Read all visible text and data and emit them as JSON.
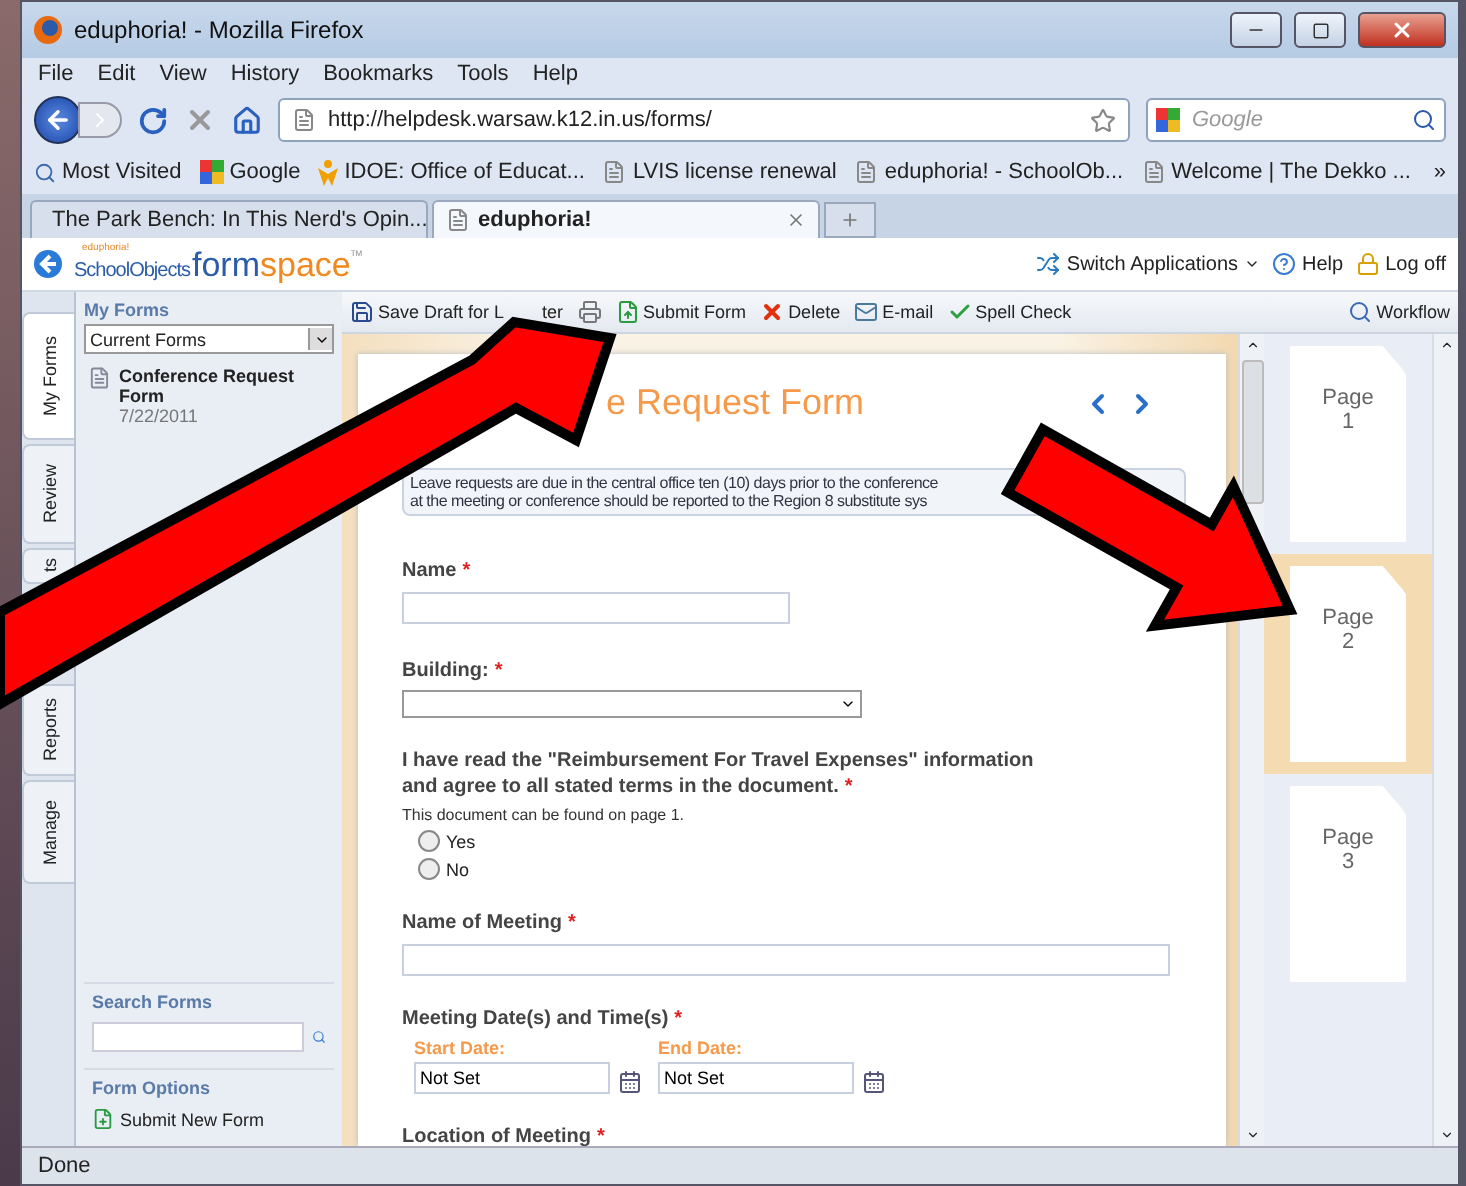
{
  "window": {
    "title": "eduphoria! - Mozilla Firefox"
  },
  "menu": [
    "File",
    "Edit",
    "View",
    "History",
    "Bookmarks",
    "Tools",
    "Help"
  ],
  "address": {
    "value": "http://helpdesk.warsaw.k12.in.us/forms/"
  },
  "search": {
    "placeholder": "Google"
  },
  "bookmarks": [
    {
      "label": "Most Visited",
      "kind": "folder"
    },
    {
      "label": "Google",
      "kind": "google"
    },
    {
      "label": "IDOE: Office of Educat...",
      "kind": "idoe"
    },
    {
      "label": "LVIS license renewal",
      "kind": "page"
    },
    {
      "label": "eduphoria! - SchoolOb...",
      "kind": "page"
    },
    {
      "label": "Welcome | The Dekko ...",
      "kind": "page"
    }
  ],
  "bookmarks_more": "»",
  "tabs": [
    {
      "label": "The Park Bench: In This Nerd's Opin...",
      "selected": false,
      "kind": "blog"
    },
    {
      "label": "eduphoria!",
      "selected": true,
      "kind": "page"
    }
  ],
  "app": {
    "logo_small": "eduphoria!",
    "logo_brand": "SchoolObjects",
    "logo_form": "form",
    "logo_space": "space",
    "logo_tm": "TM",
    "header_links": [
      {
        "label": "Switch Applications",
        "kind": "switch"
      },
      {
        "label": "Help",
        "kind": "help"
      },
      {
        "label": "Log off",
        "kind": "logoff"
      }
    ]
  },
  "side_tabs": [
    {
      "label": "My Forms",
      "selected": true
    },
    {
      "label": "Review",
      "selected": false
    },
    {
      "label": "ts",
      "selected": false
    },
    {
      "label": "Reports",
      "selected": false
    },
    {
      "label": "Manage",
      "selected": false
    }
  ],
  "sidebar": {
    "title": "My Forms",
    "filter": "Current Forms",
    "forms": [
      {
        "name": "Conference Request Form",
        "date": "7/22/2011"
      }
    ],
    "search_title": "Search Forms",
    "options_title": "Form Options",
    "options": [
      "Submit New Form"
    ]
  },
  "toolbar": [
    {
      "label": "Save Draft for L",
      "kind": "save"
    },
    {
      "label": "ter",
      "kind": "fragment"
    },
    {
      "kind": "print"
    },
    {
      "label": "Submit Form",
      "kind": "submit"
    },
    {
      "label": "Delete",
      "kind": "delete"
    },
    {
      "label": "E-mail",
      "kind": "email"
    },
    {
      "label": "Spell Check",
      "kind": "spell"
    }
  ],
  "workflow": "Workflow",
  "form": {
    "title": "e Request Form",
    "required_mark": "*",
    "notice": [
      "Leave requests are due in the central office ten (10) days prior to the conference",
      "at the meeting or conference should be reported to the Region 8 substitute sys"
    ],
    "fields": [
      {
        "kind": "short",
        "label": "Name",
        "required": true
      },
      {
        "kind": "select",
        "label": "Building:",
        "required": true
      },
      {
        "kind": "radio",
        "label": "I have read the \"Reimbursement For Travel Expenses\" information and agree to all stated terms in the document.",
        "required": true,
        "hint": "This document can be found on page 1.",
        "options": [
          {
            "label": "Yes",
            "selected": false
          },
          {
            "label": "No",
            "selected": false
          }
        ]
      },
      {
        "kind": "text",
        "label": "Name of Meeting",
        "required": true
      },
      {
        "kind": "dates",
        "label": "Meeting Date(s) and Time(s)",
        "required": true,
        "dates": [
          {
            "label": "Start Date:",
            "value": "Not Set"
          },
          {
            "label": "End Date:",
            "value": "Not Set"
          }
        ]
      },
      {
        "kind": "heading",
        "label": "Location of Meeting",
        "required": true
      }
    ]
  },
  "pages": [
    {
      "label": "Page",
      "number": "1",
      "selected": false
    },
    {
      "label": "Page",
      "number": "2",
      "selected": true
    },
    {
      "label": "Page",
      "number": "3",
      "selected": false
    }
  ],
  "status_bar": "Done"
}
